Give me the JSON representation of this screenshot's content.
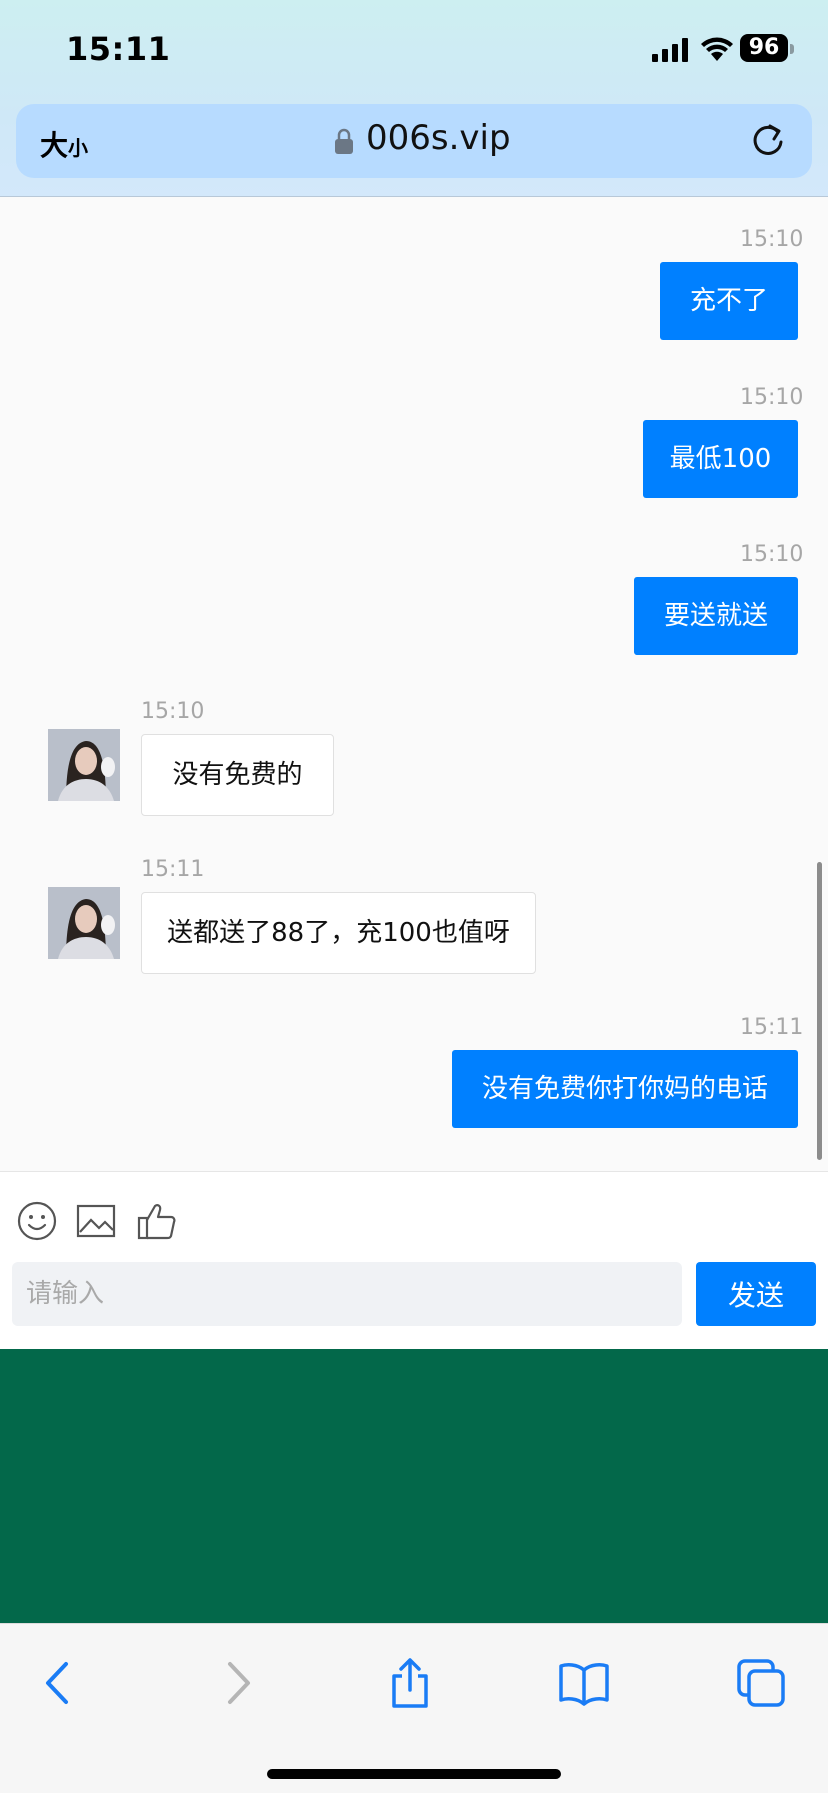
{
  "status_bar": {
    "time": "15:11",
    "battery": "96"
  },
  "browser": {
    "text_size_label_big": "大",
    "text_size_label_small": "小",
    "url": "006s.vip"
  },
  "messages": [
    {
      "dir": "out",
      "time": "15:10",
      "text": "充不了"
    },
    {
      "dir": "out",
      "time": "15:10",
      "text": "最低100"
    },
    {
      "dir": "out",
      "time": "15:10",
      "text": "要送就送"
    },
    {
      "dir": "in",
      "time": "15:10",
      "text": "没有免费的"
    },
    {
      "dir": "in",
      "time": "15:11",
      "text": "送都送了88了，充100也值呀"
    },
    {
      "dir": "out",
      "time": "15:11",
      "text": "没有免费你打你妈的电话"
    }
  ],
  "composer": {
    "placeholder": "请输入",
    "send_label": "发送"
  },
  "colors": {
    "accent": "#0080ff",
    "banner": "#03684a"
  },
  "icons": [
    "emoji-icon",
    "image-icon",
    "thumbs-up-icon",
    "back-icon",
    "forward-icon",
    "share-icon",
    "bookmarks-icon",
    "tabs-icon"
  ]
}
